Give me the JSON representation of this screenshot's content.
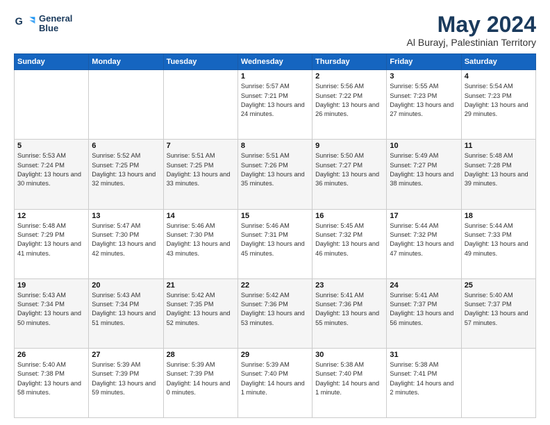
{
  "logo": {
    "line1": "General",
    "line2": "Blue"
  },
  "title": "May 2024",
  "subtitle": "Al Burayj, Palestinian Territory",
  "days_of_week": [
    "Sunday",
    "Monday",
    "Tuesday",
    "Wednesday",
    "Thursday",
    "Friday",
    "Saturday"
  ],
  "weeks": [
    [
      null,
      null,
      null,
      {
        "day": 1,
        "sunrise": "5:57 AM",
        "sunset": "7:21 PM",
        "daylight": "13 hours and 24 minutes."
      },
      {
        "day": 2,
        "sunrise": "5:56 AM",
        "sunset": "7:22 PM",
        "daylight": "13 hours and 26 minutes."
      },
      {
        "day": 3,
        "sunrise": "5:55 AM",
        "sunset": "7:23 PM",
        "daylight": "13 hours and 27 minutes."
      },
      {
        "day": 4,
        "sunrise": "5:54 AM",
        "sunset": "7:23 PM",
        "daylight": "13 hours and 29 minutes."
      }
    ],
    [
      {
        "day": 5,
        "sunrise": "5:53 AM",
        "sunset": "7:24 PM",
        "daylight": "13 hours and 30 minutes."
      },
      {
        "day": 6,
        "sunrise": "5:52 AM",
        "sunset": "7:25 PM",
        "daylight": "13 hours and 32 minutes."
      },
      {
        "day": 7,
        "sunrise": "5:51 AM",
        "sunset": "7:25 PM",
        "daylight": "13 hours and 33 minutes."
      },
      {
        "day": 8,
        "sunrise": "5:51 AM",
        "sunset": "7:26 PM",
        "daylight": "13 hours and 35 minutes."
      },
      {
        "day": 9,
        "sunrise": "5:50 AM",
        "sunset": "7:27 PM",
        "daylight": "13 hours and 36 minutes."
      },
      {
        "day": 10,
        "sunrise": "5:49 AM",
        "sunset": "7:27 PM",
        "daylight": "13 hours and 38 minutes."
      },
      {
        "day": 11,
        "sunrise": "5:48 AM",
        "sunset": "7:28 PM",
        "daylight": "13 hours and 39 minutes."
      }
    ],
    [
      {
        "day": 12,
        "sunrise": "5:48 AM",
        "sunset": "7:29 PM",
        "daylight": "13 hours and 41 minutes."
      },
      {
        "day": 13,
        "sunrise": "5:47 AM",
        "sunset": "7:30 PM",
        "daylight": "13 hours and 42 minutes."
      },
      {
        "day": 14,
        "sunrise": "5:46 AM",
        "sunset": "7:30 PM",
        "daylight": "13 hours and 43 minutes."
      },
      {
        "day": 15,
        "sunrise": "5:46 AM",
        "sunset": "7:31 PM",
        "daylight": "13 hours and 45 minutes."
      },
      {
        "day": 16,
        "sunrise": "5:45 AM",
        "sunset": "7:32 PM",
        "daylight": "13 hours and 46 minutes."
      },
      {
        "day": 17,
        "sunrise": "5:44 AM",
        "sunset": "7:32 PM",
        "daylight": "13 hours and 47 minutes."
      },
      {
        "day": 18,
        "sunrise": "5:44 AM",
        "sunset": "7:33 PM",
        "daylight": "13 hours and 49 minutes."
      }
    ],
    [
      {
        "day": 19,
        "sunrise": "5:43 AM",
        "sunset": "7:34 PM",
        "daylight": "13 hours and 50 minutes."
      },
      {
        "day": 20,
        "sunrise": "5:43 AM",
        "sunset": "7:34 PM",
        "daylight": "13 hours and 51 minutes."
      },
      {
        "day": 21,
        "sunrise": "5:42 AM",
        "sunset": "7:35 PM",
        "daylight": "13 hours and 52 minutes."
      },
      {
        "day": 22,
        "sunrise": "5:42 AM",
        "sunset": "7:36 PM",
        "daylight": "13 hours and 53 minutes."
      },
      {
        "day": 23,
        "sunrise": "5:41 AM",
        "sunset": "7:36 PM",
        "daylight": "13 hours and 55 minutes."
      },
      {
        "day": 24,
        "sunrise": "5:41 AM",
        "sunset": "7:37 PM",
        "daylight": "13 hours and 56 minutes."
      },
      {
        "day": 25,
        "sunrise": "5:40 AM",
        "sunset": "7:37 PM",
        "daylight": "13 hours and 57 minutes."
      }
    ],
    [
      {
        "day": 26,
        "sunrise": "5:40 AM",
        "sunset": "7:38 PM",
        "daylight": "13 hours and 58 minutes."
      },
      {
        "day": 27,
        "sunrise": "5:39 AM",
        "sunset": "7:39 PM",
        "daylight": "13 hours and 59 minutes."
      },
      {
        "day": 28,
        "sunrise": "5:39 AM",
        "sunset": "7:39 PM",
        "daylight": "14 hours and 0 minutes."
      },
      {
        "day": 29,
        "sunrise": "5:39 AM",
        "sunset": "7:40 PM",
        "daylight": "14 hours and 1 minute."
      },
      {
        "day": 30,
        "sunrise": "5:38 AM",
        "sunset": "7:40 PM",
        "daylight": "14 hours and 1 minute."
      },
      {
        "day": 31,
        "sunrise": "5:38 AM",
        "sunset": "7:41 PM",
        "daylight": "14 hours and 2 minutes."
      },
      null
    ]
  ]
}
